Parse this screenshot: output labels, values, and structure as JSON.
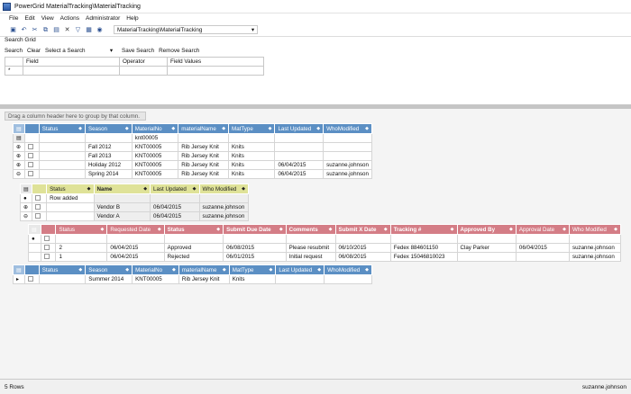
{
  "window": {
    "title": "PowerGrid MaterialTracking\\MaterialTracking"
  },
  "menu": [
    "File",
    "Edit",
    "View",
    "Actions",
    "Administrator",
    "Help"
  ],
  "toolbar": {
    "path_value": "MaterialTracking\\MaterialTracking"
  },
  "search": {
    "label": "Search Grid",
    "buttons": [
      "Search",
      "Clear",
      "Select a Search",
      "Save Search",
      "Remove Search"
    ],
    "columns": [
      "Field",
      "Operator",
      "Field Values"
    ],
    "new_row_marker": "*"
  },
  "group_hint": "Drag a column header here to group by that column.",
  "grid1": {
    "columns": [
      "Status",
      "Season",
      "MaterialNo",
      "materialName",
      "MatType",
      "Last Updated",
      "WhoModified"
    ],
    "filter_value": "knt00005",
    "rows": [
      [
        "",
        "Fall 2012",
        "KNT00005",
        "Rib Jersey Knit",
        "Knits",
        "",
        ""
      ],
      [
        "",
        "Fall 2013",
        "KNT00005",
        "Rib Jersey Knit",
        "Knits",
        "",
        ""
      ],
      [
        "",
        "Holiday 2012",
        "KNT00005",
        "Rib Jersey Knit",
        "Knits",
        "06/04/2015",
        "suzanne.johnson"
      ],
      [
        "",
        "Spring 2014",
        "KNT00005",
        "Rib Jersey Knit",
        "Knits",
        "06/04/2015",
        "suzanne.johnson"
      ]
    ]
  },
  "grid2": {
    "columns": [
      "Status",
      "Name",
      "Last Updated",
      "Who Modified"
    ],
    "rows": [
      [
        "Row added",
        "",
        "",
        ""
      ],
      [
        "",
        "Vendor B",
        "06/04/2015",
        "suzanne.johnson"
      ],
      [
        "",
        "Vendor A",
        "06/04/2015",
        "suzanne.johnson"
      ]
    ]
  },
  "grid3": {
    "columns": [
      "Status",
      "Requested Date",
      "Status",
      "Submit Due Date",
      "Comments",
      "Submit X Date",
      "Tracking #",
      "Approved By",
      "Approval Date",
      "Who Modified"
    ],
    "rows": [
      [
        "2",
        "06/04/2015",
        "Approved",
        "06/08/2015",
        "Please resubmit",
        "06/10/2015",
        "Fedex 884601150",
        "Clay Parker",
        "06/04/2015",
        "suzanne.johnson"
      ],
      [
        "1",
        "06/04/2015",
        "Rejected",
        "06/01/2015",
        "Initial request",
        "06/08/2015",
        "Fedex 15046810023",
        "",
        "",
        "suzanne.johnson"
      ]
    ]
  },
  "grid4": {
    "columns": [
      "Status",
      "Season",
      "MaterialNo",
      "materialName",
      "MatType",
      "Last Updated",
      "WhoModified"
    ],
    "rows": [
      [
        "",
        "Summer 2014",
        "KNT00005",
        "Rib Jersey Knit",
        "Knits",
        "",
        ""
      ]
    ]
  },
  "statusbar": {
    "rows": "5 Rows",
    "user": "suzanne.johnson"
  }
}
